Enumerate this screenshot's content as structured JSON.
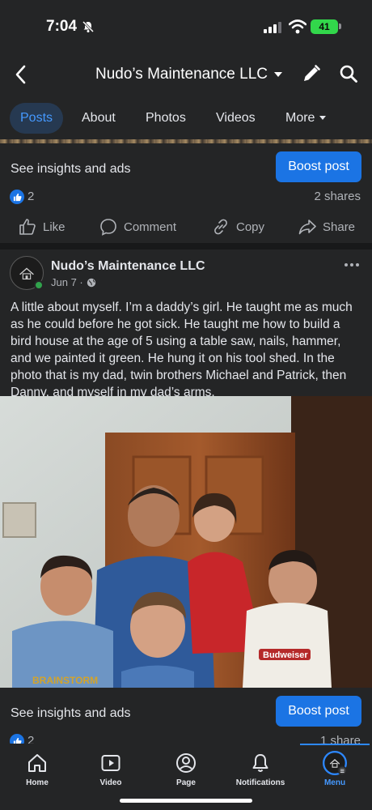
{
  "status_bar": {
    "time": "7:04",
    "battery": "41"
  },
  "header": {
    "page_name": "Nudo’s Maintenance LLC"
  },
  "tabs": [
    {
      "label": "Posts",
      "active": true
    },
    {
      "label": "About"
    },
    {
      "label": "Photos"
    },
    {
      "label": "Videos"
    },
    {
      "label": "More"
    }
  ],
  "insights": {
    "label": "See insights and ads",
    "boost_label": "Boost post"
  },
  "prev_post": {
    "reaction_count": "2",
    "shares": "2 shares"
  },
  "actions": {
    "like": "Like",
    "comment": "Comment",
    "copy": "Copy",
    "share": "Share"
  },
  "post": {
    "author": "Nudo’s Maintenance LLC",
    "date": "Jun 7 ·",
    "text": "A little about myself. I’m a daddy’s girl. He taught me as much as he could before he got sick. He taught me how to build a bird house at the age of 5 using a table saw, nails, hammer, and we painted it green. He hung it on his tool shed. In the photo that is my dad, twin brothers Michael and Patrick, then Danny, and myself in my dad’s arms.",
    "photo_shirt_text": "Budweiser",
    "photo_shirt_text_2": "BRAINSTORM",
    "reaction_count": "2",
    "shares": "1 share"
  },
  "bottom_nav": [
    {
      "label": "Home",
      "icon": "home-icon"
    },
    {
      "label": "Video",
      "icon": "video-icon"
    },
    {
      "label": "Page",
      "icon": "page-icon"
    },
    {
      "label": "Notifications",
      "icon": "bell-icon"
    },
    {
      "label": "Menu",
      "icon": "menu-icon",
      "active": true
    }
  ],
  "colors": {
    "accent": "#1b74e4",
    "active_tab": "#4599ff",
    "background": "#242526"
  }
}
